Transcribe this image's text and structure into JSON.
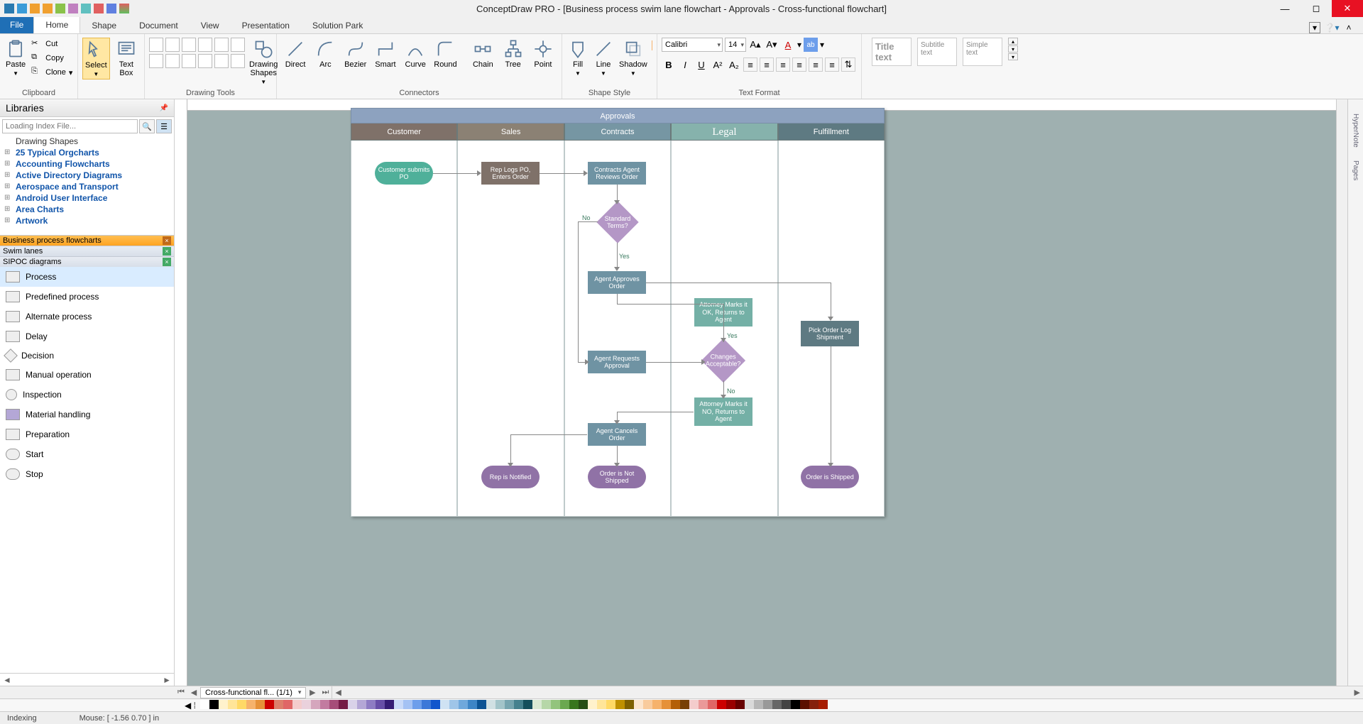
{
  "window": {
    "title": "ConceptDraw PRO - [Business process swim lane flowchart - Approvals - Cross-functional flowchart]"
  },
  "tabs": {
    "file": "File",
    "items": [
      "Home",
      "Shape",
      "Document",
      "View",
      "Presentation",
      "Solution Park"
    ],
    "active": "Home"
  },
  "ribbon": {
    "clipboard": {
      "label": "Clipboard",
      "paste": "Paste",
      "cut": "Cut",
      "copy": "Copy",
      "clone": "Clone"
    },
    "select": "Select",
    "textbox": "Text\nBox",
    "drawing_tools": {
      "label": "Drawing Tools",
      "shapes": "Drawing\nShapes"
    },
    "connectors": {
      "label": "Connectors",
      "items": [
        "Direct",
        "Arc",
        "Bezier",
        "Smart",
        "Curve",
        "Round",
        "Chain",
        "Tree",
        "Point"
      ]
    },
    "shape_style": {
      "label": "Shape Style",
      "fill": "Fill",
      "line": "Line",
      "shadow": "Shadow"
    },
    "text_format": {
      "label": "Text Format",
      "font": "Calibri",
      "size": "14"
    },
    "text_presets": [
      "Title text",
      "Subtitle text",
      "Simple text"
    ]
  },
  "sidebar": {
    "title": "Libraries",
    "search_placeholder": "Loading Index File...",
    "tree_first": "Drawing Shapes",
    "tree": [
      "25 Typical Orgcharts",
      "Accounting Flowcharts",
      "Active Directory Diagrams",
      "Aerospace and Transport",
      "Android User Interface",
      "Area Charts",
      "Artwork"
    ],
    "lib_tabs": [
      "Business process flowcharts",
      "Swim lanes",
      "SIPOC diagrams"
    ],
    "shapes": [
      "Process",
      "Predefined process",
      "Alternate process",
      "Delay",
      "Decision",
      "Manual operation",
      "Inspection",
      "Material handling",
      "Preparation",
      "Start",
      "Stop"
    ]
  },
  "swimlane": {
    "title": "Approvals",
    "lanes": [
      {
        "name": "Customer",
        "color": "#7f7169"
      },
      {
        "name": "Sales",
        "color": "#8b8174"
      },
      {
        "name": "Contracts",
        "color": "#7696a3"
      },
      {
        "name": "Legal",
        "color": "#86b2ac",
        "active": true
      },
      {
        "name": "Fulfillment",
        "color": "#5e7a82"
      }
    ],
    "nodes": {
      "cust_submit": "Customer submits PO",
      "rep_logs": "Rep Logs PO, Enters Order",
      "agent_review": "Contracts Agent Reviews Order",
      "std_terms": "Standard Terms?",
      "agent_approves": "Agent Approves Order",
      "att_ok": "Attorney Marks it OK, Returns to Agent",
      "changes": "Changes Acceptable?",
      "att_no": "Attorney Marks it NO, Returns to Agent",
      "agent_req": "Agent Requests Approval",
      "agent_cancel": "Agent Cancels Order",
      "rep_notified": "Rep is Notified",
      "not_shipped": "Order is Not Shipped",
      "pick": "Pick Order Log Shipment",
      "shipped": "Order is Shipped"
    },
    "edge_labels": {
      "no": "No",
      "yes": "Yes",
      "yes2": "Yes",
      "no2": "No"
    }
  },
  "pagetab": "Cross-functional fl...  (1/1)",
  "status": {
    "left": "Indexing",
    "mouse": "Mouse: [  -1.56  0.70 ]  in"
  },
  "colors": [
    "#ffffff",
    "#000000",
    "#fff2cc",
    "#ffe599",
    "#ffd966",
    "#f6b26b",
    "#e69138",
    "#cc0000",
    "#dd7e6b",
    "#e06666",
    "#f4cccc",
    "#ead1dc",
    "#d5a6bd",
    "#c27ba0",
    "#a64d79",
    "#741b47",
    "#d9d2e9",
    "#b4a7d6",
    "#8e7cc3",
    "#674ea7",
    "#351c75",
    "#c9daf8",
    "#a4c2f4",
    "#6d9eeb",
    "#3c78d8",
    "#1155cc",
    "#cfe2f3",
    "#9fc5e8",
    "#6fa8dc",
    "#3d85c6",
    "#0b5394",
    "#d0e0e3",
    "#a2c4c9",
    "#76a5af",
    "#45818e",
    "#134f5c",
    "#d9ead3",
    "#b6d7a8",
    "#93c47d",
    "#6aa84f",
    "#38761d",
    "#274e13",
    "#fff2cc",
    "#ffe599",
    "#ffd966",
    "#bf9000",
    "#7f6000",
    "#fce5cd",
    "#f9cb9c",
    "#f6b26b",
    "#e69138",
    "#b45f06",
    "#783f04",
    "#f4cccc",
    "#ea9999",
    "#e06666",
    "#cc0000",
    "#990000",
    "#660000",
    "#d9d9d9",
    "#b7b7b7",
    "#999999",
    "#666666",
    "#434343",
    "#000000",
    "#5b0f00",
    "#85200c",
    "#a61c00"
  ]
}
